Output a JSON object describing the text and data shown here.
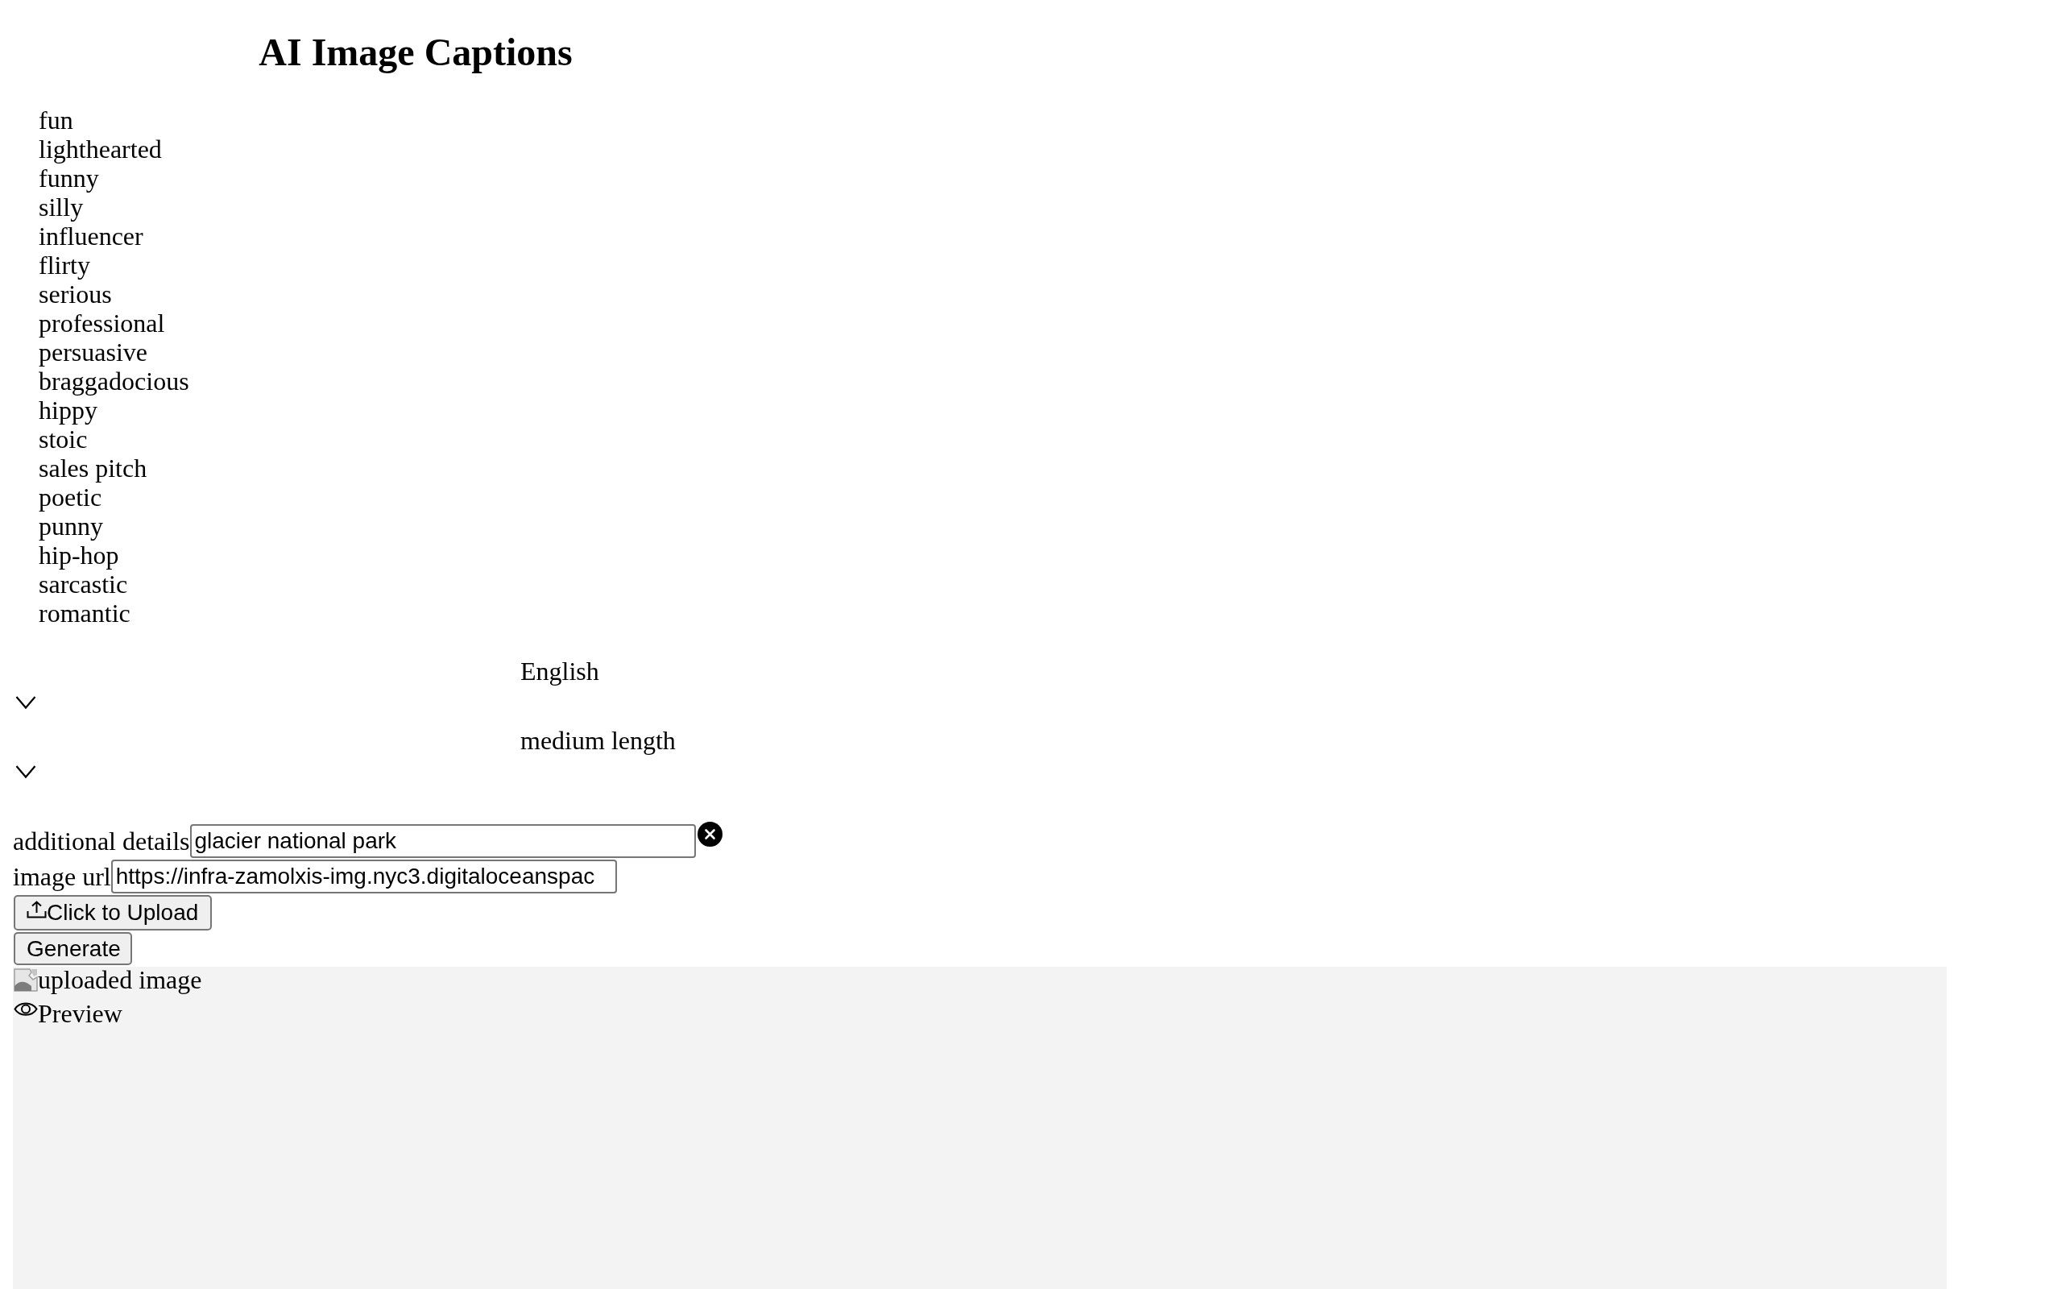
{
  "title": "AI Image Captions",
  "tones": [
    "fun",
    "lighthearted",
    "funny",
    "silly",
    "influencer",
    "flirty",
    "serious",
    "professional",
    "persuasive",
    "braggadocious",
    "hippy",
    "stoic",
    "sales pitch",
    "poetic",
    "punny",
    "hip-hop",
    "sarcastic",
    "romantic"
  ],
  "dropdowns": [
    {
      "value": "English"
    },
    {
      "value": "medium length"
    }
  ],
  "fields": [
    {
      "label": "additional details",
      "value": "glacier national park",
      "clearable": true
    },
    {
      "label": "image url",
      "value": "https://infra-zamolxis-img.nyc3.digitaloceanspac",
      "clearable": false
    }
  ],
  "buttons": [
    {
      "kind": "upload",
      "label": "Click to Upload"
    },
    {
      "kind": "plain",
      "label": "Generate"
    }
  ],
  "preview": {
    "image_alt": "uploaded image",
    "label": "Preview"
  }
}
